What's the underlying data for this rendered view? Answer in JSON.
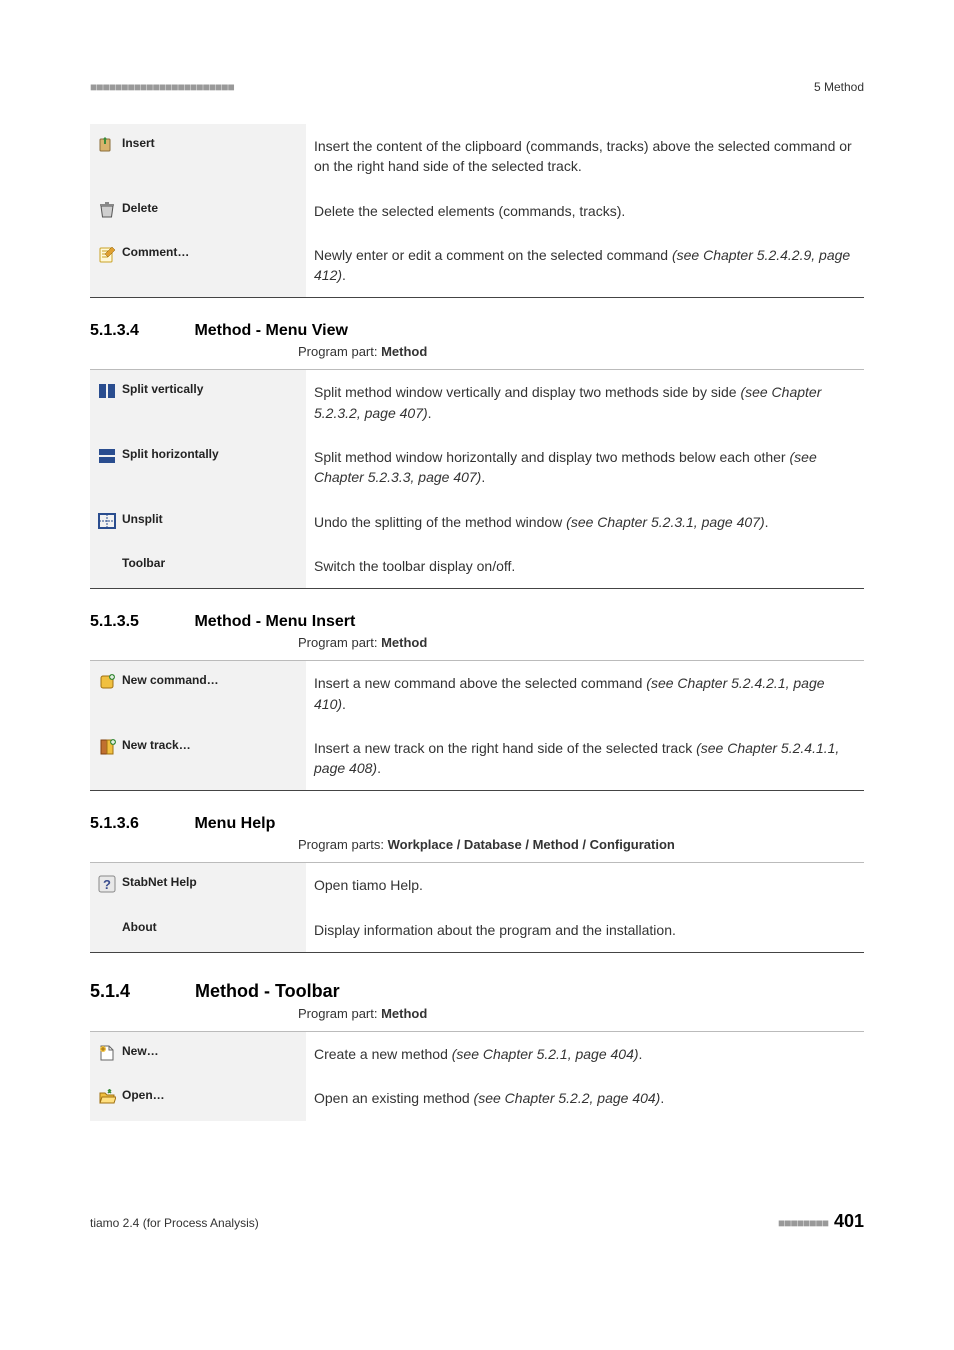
{
  "header": {
    "marks": "■■■■■■■■■■■■■■■■■■■■■■■",
    "chapter": "5 Method"
  },
  "tables": {
    "edit": [
      {
        "label": "Insert",
        "icon": "insert-icon",
        "desc_html": "Insert the content of the clipboard (commands, tracks) above the selected command or on the right hand side of the selected track."
      },
      {
        "label": "Delete",
        "icon": "delete-icon",
        "desc_html": "Delete the selected elements (commands, tracks)."
      },
      {
        "label": "Comment…",
        "icon": "comment-icon",
        "desc_html": "Newly enter or edit a comment on the selected command <em>(see Chapter 5.2.4.2.9, page 412)</em>."
      }
    ],
    "view": [
      {
        "label": "Split vertically",
        "icon": "split-vertically-icon",
        "desc_html": "Split method window vertically and display two methods side by side <em>(see Chapter 5.2.3.2, page 407)</em>."
      },
      {
        "label": "Split horizontally",
        "icon": "split-horizontally-icon",
        "desc_html": "Split method window horizontally and display two methods below each other <em>(see Chapter 5.2.3.3, page 407)</em>."
      },
      {
        "label": "Unsplit",
        "icon": "unsplit-icon",
        "desc_html": "Undo the splitting of the method window <em>(see Chapter 5.2.3.1, page 407)</em>."
      },
      {
        "label": "Toolbar",
        "icon": null,
        "desc_html": "Switch the toolbar display on/off."
      }
    ],
    "insert": [
      {
        "label": "New command…",
        "icon": "new-command-icon",
        "desc_html": "Insert a new command above the selected command <em>(see Chapter 5.2.4.2.1, page 410)</em>."
      },
      {
        "label": "New track…",
        "icon": "new-track-icon",
        "desc_html": "Insert a new track on the right hand side of the selected track <em>(see Chapter 5.2.4.1.1, page 408)</em>."
      }
    ],
    "help": [
      {
        "label": "StabNet Help",
        "icon": "help-icon",
        "desc_html": "Open tiamo Help."
      },
      {
        "label": "About",
        "icon": null,
        "desc_html": "Display information about the program and the installation."
      }
    ],
    "toolbar": [
      {
        "label": "New…",
        "icon": "new-file-icon",
        "desc_html": "Create a new method <em>(see Chapter 5.2.1, page 404)</em>."
      },
      {
        "label": "Open…",
        "icon": "open-folder-icon",
        "desc_html": "Open an existing method <em>(see Chapter 5.2.2, page 404)</em>."
      }
    ]
  },
  "sections": {
    "s5134": {
      "num": "5.1.3.4",
      "title": "Method - Menu View",
      "sub_plain": "Program part: ",
      "sub_bold": "Method"
    },
    "s5135": {
      "num": "5.1.3.5",
      "title": "Method - Menu Insert",
      "sub_plain": "Program part: ",
      "sub_bold": "Method"
    },
    "s5136": {
      "num": "5.1.3.6",
      "title": "Menu Help",
      "sub_plain": "Program parts: ",
      "sub_bold": "Workplace / Database / Method / Configuration"
    },
    "s514": {
      "num": "5.1.4",
      "title": "Method - Toolbar",
      "sub_plain": "Program part: ",
      "sub_bold": "Method"
    }
  },
  "footer": {
    "left": "tiamo 2.4 (for Process Analysis)",
    "marks": "■■■■■■■■",
    "page": "401"
  }
}
